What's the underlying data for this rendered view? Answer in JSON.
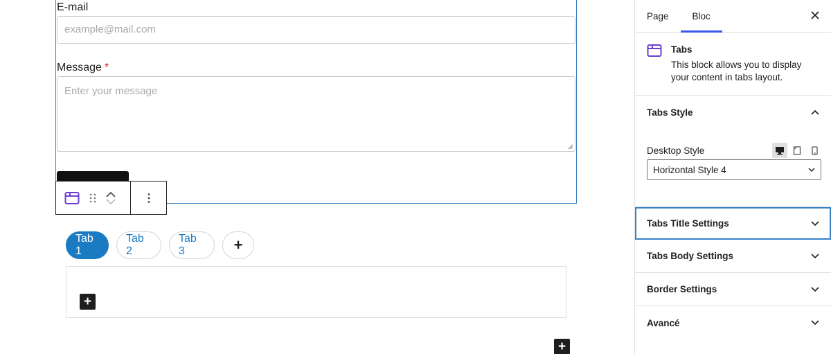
{
  "form": {
    "email_label": "E-mail",
    "email_placeholder": "example@mail.com",
    "message_label": "Message",
    "required_mark": "*",
    "message_placeholder": "Enter your message"
  },
  "block_toolbar": {
    "block_icon": "tabs-icon",
    "drag_icon": "drag-handle-icon",
    "move_up_icon": "chevron-up-icon",
    "move_down_icon": "chevron-down-icon",
    "more_icon": "more-vertical-icon"
  },
  "tabs_block": {
    "tabs": [
      {
        "label": "Tab 1",
        "active": true
      },
      {
        "label": "Tab 2",
        "active": false
      },
      {
        "label": "Tab 3",
        "active": false
      }
    ],
    "add_tab_label": "+",
    "inserter_label": "+"
  },
  "sidebar": {
    "tabs": [
      {
        "label": "Page",
        "active": false
      },
      {
        "label": "Bloc",
        "active": true
      }
    ],
    "close_icon": "close-icon",
    "block_card": {
      "title": "Tabs",
      "description": "This block allows you to display your content in tabs layout."
    },
    "tabs_style": {
      "title": "Tabs Style",
      "expanded": true,
      "desktop_style_label": "Desktop Style",
      "devices": [
        "desktop-icon",
        "tablet-icon",
        "mobile-icon"
      ],
      "active_device": "desktop-icon",
      "selected_style": "Horizontal Style 4"
    },
    "panels": [
      {
        "title": "Tabs Title Settings",
        "focused": true
      },
      {
        "title": "Tabs Body Settings",
        "focused": false
      },
      {
        "title": "Border Settings",
        "focused": false
      },
      {
        "title": "Avancé",
        "focused": false
      }
    ]
  },
  "colors": {
    "accent_blue": "#1a7bc3",
    "wp_blue": "#3858e9",
    "selection_blue": "#3582c4",
    "required_red": "#cc1818"
  }
}
